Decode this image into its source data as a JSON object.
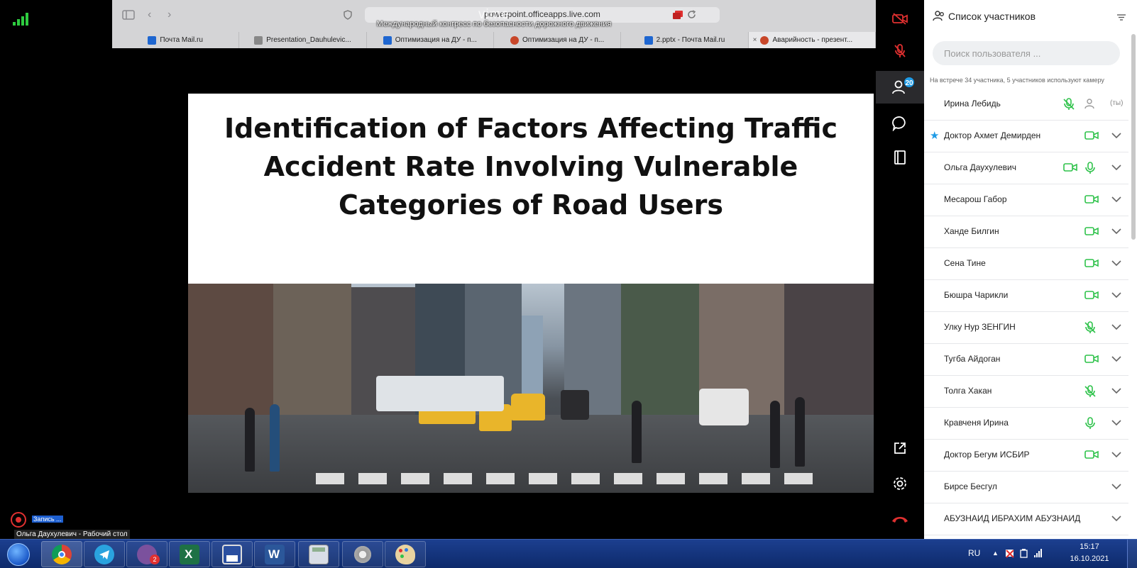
{
  "browser": {
    "url": "powerpoint.officeapps.live.com",
    "overlay_logo": "vime",
    "meeting_subtitle": "Международный конгресс по безопасности дорожного движения",
    "tabs": [
      {
        "label": "Почта Mail.ru",
        "color": "#1e66d0"
      },
      {
        "label": "Presentation_Dauhulevic...",
        "color": "#888888"
      },
      {
        "label": "Оптимизация на ДУ - п...",
        "color": "#1e66d0"
      },
      {
        "label": "Оптимизация на ДУ - п...",
        "color": "#c8472a"
      },
      {
        "label": "2.pptx - Почта Mail.ru",
        "color": "#1e66d0"
      },
      {
        "label": "Аварийность - презент...",
        "color": "#c8472a"
      }
    ]
  },
  "slide": {
    "title": "Identification of Factors Affecting Traffic Accident Rate Involving Vulnerable Categories of Road Users"
  },
  "toolbar": {
    "participants_badge": "20"
  },
  "panel": {
    "title": "Список участников",
    "search_placeholder": "Поиск пользователя ...",
    "count_text": "На встрече 34 участника, 5 участников используют камеру",
    "you_label": "(ты)",
    "participants": [
      {
        "name": "Ирина Лебидь",
        "icons": [
          "mic-off",
          "user"
        ],
        "you": true
      },
      {
        "name": "Доктор Ахмет Демирден",
        "icons": [
          "camera"
        ],
        "star": true
      },
      {
        "name": "Ольга Даухулевич",
        "icons": [
          "camera",
          "mic"
        ]
      },
      {
        "name": "Месарош Габор",
        "icons": [
          "camera"
        ]
      },
      {
        "name": "Ханде Билгин",
        "icons": [
          "camera"
        ]
      },
      {
        "name": "Сена Тине",
        "icons": [
          "camera"
        ]
      },
      {
        "name": "Бюшра Чарикли",
        "icons": [
          "camera"
        ]
      },
      {
        "name": "Улку Нур ЗЕНГИН",
        "icons": [
          "mic-off"
        ]
      },
      {
        "name": "Тугба Айдоган",
        "icons": [
          "camera"
        ]
      },
      {
        "name": "Толга Хакан",
        "icons": [
          "mic-off"
        ]
      },
      {
        "name": "Кравченя Ирина",
        "icons": [
          "mic"
        ]
      },
      {
        "name": "Доктор Бегум ИСБИР",
        "icons": [
          "camera"
        ]
      },
      {
        "name": "Бирсе Бесгул",
        "icons": []
      },
      {
        "name": "АБУЗНАИД ИБРАХИМ АБУЗНАИД",
        "icons": []
      }
    ]
  },
  "recording": {
    "label": "Запись ...",
    "source": "Ольга Даухулевич - Рабочий стол"
  },
  "taskbar": {
    "viber_badge": "2",
    "lang": "RU",
    "time": "15:17",
    "date": "16.10.2021"
  },
  "colors": {
    "accent_green": "#2ec24a",
    "accent_blue": "#1e9be6",
    "hangup_red": "#e03030"
  }
}
